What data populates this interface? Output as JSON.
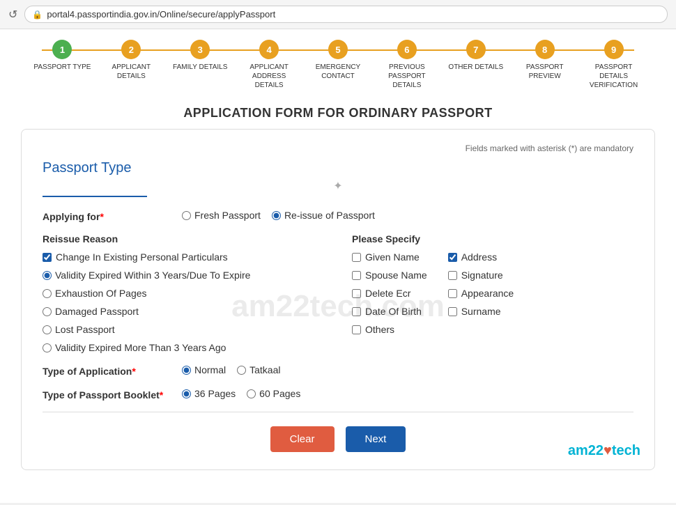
{
  "browser": {
    "url": "portal4.passportindia.gov.in/Online/secure/applyPassport",
    "refresh_icon": "↺",
    "lock_icon": "🔒"
  },
  "steps": [
    {
      "number": "1",
      "label": "PASSPORT TYPE",
      "state": "completed"
    },
    {
      "number": "2",
      "label": "APPLICANT DETAILS",
      "state": "active"
    },
    {
      "number": "3",
      "label": "FAMILY DETAILS",
      "state": "active"
    },
    {
      "number": "4",
      "label": "APPLICANT ADDRESS DETAILS",
      "state": "active"
    },
    {
      "number": "5",
      "label": "EMERGENCY CONTACT",
      "state": "active"
    },
    {
      "number": "6",
      "label": "PREVIOUS PASSPORT DETAILS",
      "state": "active"
    },
    {
      "number": "7",
      "label": "OTHER DETAILS",
      "state": "active"
    },
    {
      "number": "8",
      "label": "PASSPORT PREVIEW",
      "state": "active"
    },
    {
      "number": "9",
      "label": "PASSPORT DETAILS VERIFICATION",
      "state": "active"
    }
  ],
  "page_title": "APPLICATION FORM FOR ORDINARY PASSPORT",
  "mandatory_note": "Fields marked with asterisk (*) are mandatory",
  "section_title": "Passport Type",
  "applying_for": {
    "label": "Applying for",
    "required": true,
    "options": [
      {
        "id": "fresh",
        "label": "Fresh Passport",
        "checked": false
      },
      {
        "id": "reissue",
        "label": "Re-issue of Passport",
        "checked": true
      }
    ]
  },
  "reissue_reason": {
    "title": "Reissue Reason",
    "options": [
      {
        "id": "change_particulars",
        "label": "Change In Existing Personal Particulars",
        "type": "checkbox",
        "checked": true
      },
      {
        "id": "validity_expired",
        "label": "Validity Expired Within 3 Years/Due To Expire",
        "type": "radio",
        "checked": true
      },
      {
        "id": "exhaustion_pages",
        "label": "Exhaustion Of Pages",
        "type": "radio",
        "checked": false
      },
      {
        "id": "damaged",
        "label": "Damaged Passport",
        "type": "radio",
        "checked": false
      },
      {
        "id": "lost",
        "label": "Lost Passport",
        "type": "radio",
        "checked": false
      },
      {
        "id": "validity_more",
        "label": "Validity Expired More Than 3 Years Ago",
        "type": "radio",
        "checked": false
      }
    ]
  },
  "please_specify": {
    "title": "Please Specify",
    "col1": [
      {
        "id": "given_name",
        "label": "Given Name",
        "checked": false
      },
      {
        "id": "spouse_name",
        "label": "Spouse Name",
        "checked": false
      },
      {
        "id": "delete_ecr",
        "label": "Delete Ecr",
        "checked": false
      },
      {
        "id": "date_of_birth",
        "label": "Date Of Birth",
        "checked": false
      },
      {
        "id": "others",
        "label": "Others",
        "checked": false
      }
    ],
    "col2": [
      {
        "id": "address",
        "label": "Address",
        "checked": true
      },
      {
        "id": "signature",
        "label": "Signature",
        "checked": false
      },
      {
        "id": "appearance",
        "label": "Appearance",
        "checked": false
      },
      {
        "id": "surname",
        "label": "Surname",
        "checked": false
      }
    ]
  },
  "type_of_application": {
    "label": "Type of Application",
    "required": true,
    "options": [
      {
        "id": "normal",
        "label": "Normal",
        "checked": true
      },
      {
        "id": "tatkaal",
        "label": "Tatkaal",
        "checked": false
      }
    ]
  },
  "type_of_booklet": {
    "label": "Type of Passport Booklet",
    "required": true,
    "options": [
      {
        "id": "36pages",
        "label": "36 Pages",
        "checked": true
      },
      {
        "id": "60pages",
        "label": "60 Pages",
        "checked": false
      }
    ]
  },
  "buttons": {
    "clear": "Clear",
    "next": "Next"
  },
  "watermark": "am22tech.com",
  "logo": {
    "text_before": "am22",
    "heart": "♥",
    "text_after": "tech"
  }
}
